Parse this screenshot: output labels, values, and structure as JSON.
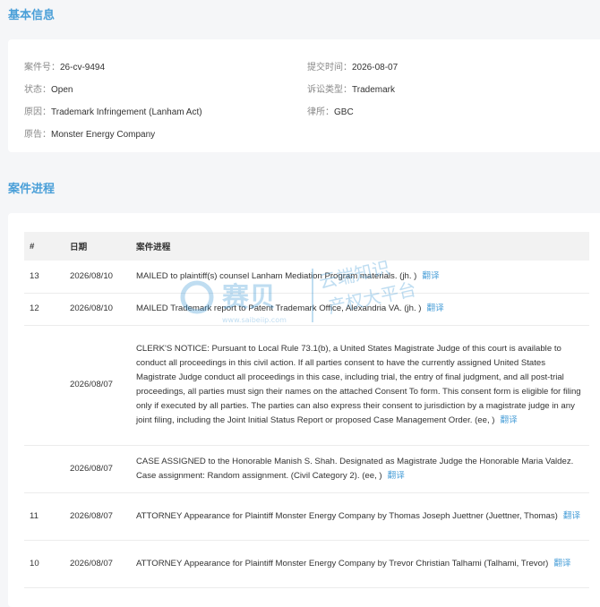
{
  "basic_info": {
    "title": "基本信息",
    "case_no_label": "案件号：",
    "case_no": "26-cv-9494",
    "submit_time_label": "提交时间：",
    "submit_time": "2026-08-07",
    "status_label": "状态：",
    "status": "Open",
    "lawsuit_type_label": "诉讼类型：",
    "lawsuit_type": "Trademark",
    "cause_label": "原因：",
    "cause": "Trademark Infringement (Lanham Act)",
    "firm_label": "律所：",
    "firm": "GBC",
    "plaintiff_label": "原告：",
    "plaintiff": "Monster Energy Company"
  },
  "progress": {
    "title": "案件进程",
    "headers": {
      "num": "#",
      "date": "日期",
      "progress": "案件进程"
    },
    "translate_label": "翻译",
    "rows": [
      {
        "num": "13",
        "date": "2026/08/10",
        "text": "MAILED to plaintiff(s) counsel Lanham Mediation Program materials. (jh. )"
      },
      {
        "num": "12",
        "date": "2026/08/10",
        "text": "MAILED Trademark report to Patent Trademark Office, Alexandria VA. (jh. )"
      },
      {
        "num": "",
        "date": "2026/08/07",
        "text": "CLERK'S NOTICE: Pursuant to Local Rule 73.1(b), a United States Magistrate Judge of this court is available to conduct all proceedings in this civil action. If all parties consent to have the currently assigned United States Magistrate Judge conduct all proceedings in this case, including trial, the entry of final judgment, and all post-trial proceedings, all parties must sign their names on the attached Consent To form. This consent form is eligible for filing only if executed by all parties. The parties can also express their consent to jurisdiction by a magistrate judge in any joint filing, including the Joint Initial Status Report or proposed Case Management Order. (ee, )"
      },
      {
        "num": "",
        "date": "2026/08/07",
        "text": "CASE ASSIGNED to the Honorable Manish S. Shah. Designated as Magistrate Judge the Honorable Maria Valdez. Case assignment: Random assignment. (Civil Category 2). (ee, )"
      },
      {
        "num": "11",
        "date": "2026/08/07",
        "text": "ATTORNEY Appearance for Plaintiff Monster Energy Company by Thomas Joseph Juettner (Juettner, Thomas)"
      },
      {
        "num": "10",
        "date": "2026/08/07",
        "text": "ATTORNEY Appearance for Plaintiff Monster Energy Company by Trevor Christian Talhami (Talhami, Trevor)"
      }
    ]
  },
  "watermark": {
    "brand": "赛贝",
    "slogan_1": "云端知识",
    "slogan_2": "产权大平台",
    "url": "www.saibeiip.com",
    "color": "#4a9fd8"
  }
}
